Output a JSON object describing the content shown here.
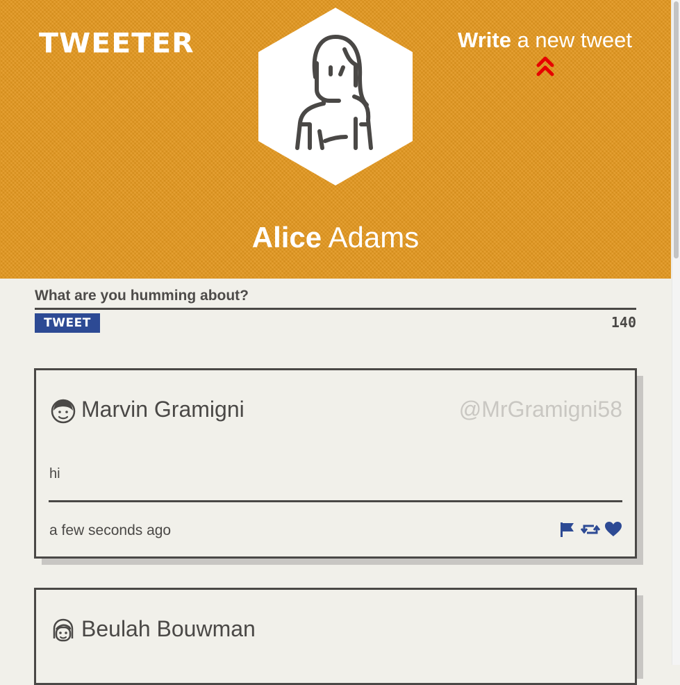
{
  "app": {
    "logo": "TWEETER"
  },
  "header": {
    "compose_strong": "Write",
    "compose_rest": " a new tweet",
    "profile_first": "Alice",
    "profile_last": " Adams",
    "avatar_icon": "woman-avatar-icon",
    "bg_color": "#e3971f"
  },
  "composer": {
    "placeholder": "What are you humming about?",
    "button_label": "TWEET",
    "char_count": "140"
  },
  "tweets": [
    {
      "name": "Marvin Gramigni",
      "handle": "@MrGramigni58",
      "body": "hi",
      "time": "a few seconds ago",
      "avatar_icon": "man-avatar-icon"
    },
    {
      "name": "Beulah Bouwman",
      "handle": "",
      "body": "",
      "time": "",
      "avatar_icon": "woman-avatar-icon"
    }
  ],
  "colors": {
    "accent": "#2d4a94",
    "chevron": "#e60000",
    "text": "#4a4846",
    "page": "#f1f0ea"
  }
}
